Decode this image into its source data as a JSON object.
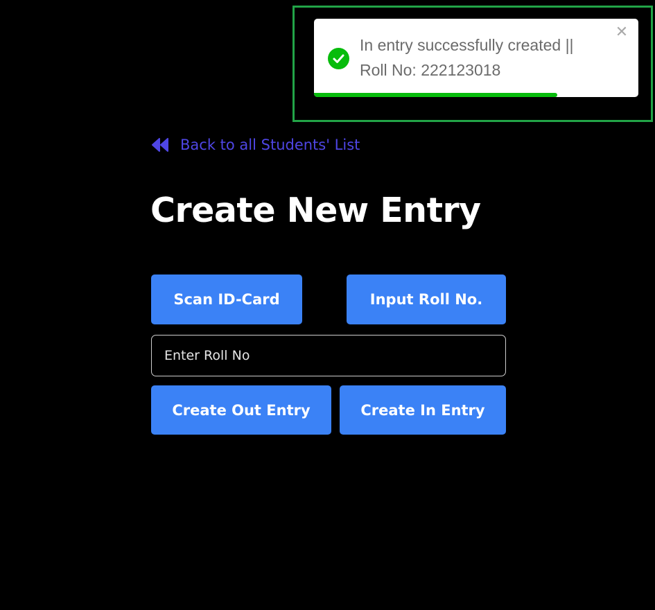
{
  "toast": {
    "message_line1": "In entry successfully created ||",
    "message_line2": "Roll No: 222123018",
    "close_symbol": "✕",
    "progress_fraction": 0.75,
    "icon": "check-circle-icon",
    "status_color": "#07bc0c",
    "highlight_color": "#22a447"
  },
  "nav": {
    "back_label": "Back to all Students' List",
    "back_icon": "double-chevron-left-icon",
    "link_color": "#4f46e5"
  },
  "page": {
    "title": "Create New Entry"
  },
  "mode_buttons": {
    "scan_label": "Scan ID-Card",
    "input_label": "Input Roll No."
  },
  "roll_input": {
    "placeholder": "Enter Roll No",
    "value": ""
  },
  "action_buttons": {
    "out_label": "Create Out Entry",
    "in_label": "Create In Entry"
  },
  "theme": {
    "accent": "#3b82f6",
    "background": "#000000"
  }
}
